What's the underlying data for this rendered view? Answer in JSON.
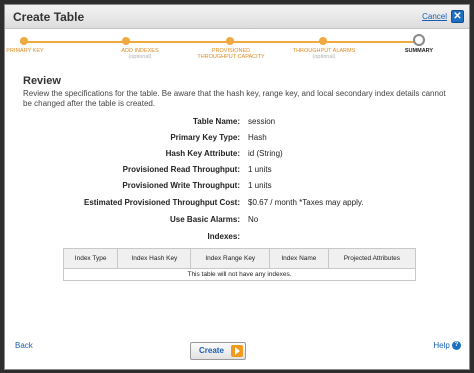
{
  "dialog": {
    "title": "Create Table",
    "cancel_label": "Cancel",
    "close_glyph": "✕"
  },
  "wizard": {
    "steps": [
      {
        "label": "PRIMARY KEY",
        "sub": ""
      },
      {
        "label": "ADD INDEXES",
        "sub": "(optional)"
      },
      {
        "label": "PROVISIONED THROUGHPUT CAPACITY",
        "sub": ""
      },
      {
        "label": "THROUGHPUT ALARMS",
        "sub": "(optional)"
      },
      {
        "label": "SUMMARY",
        "sub": ""
      }
    ],
    "current": "SUMMARY"
  },
  "review": {
    "heading": "Review",
    "intro": "Review the specifications for the table. Be aware that the hash key, range key, and local secondary index details cannot be changed after the table is created.",
    "fields": [
      {
        "label": "Table Name:",
        "value": "session"
      },
      {
        "label": "Primary Key Type:",
        "value": "Hash"
      },
      {
        "label": "Hash Key Attribute:",
        "value": "id (String)"
      },
      {
        "label": "Provisioned Read Throughput:",
        "value": "1 units"
      },
      {
        "label": "Provisioned Write Throughput:",
        "value": "1 units"
      },
      {
        "label": "Estimated Provisioned Throughput Cost:",
        "value": "$0.67 / month *Taxes may apply."
      },
      {
        "label": "Use Basic Alarms:",
        "value": "No"
      },
      {
        "label": "Indexes:",
        "value": ""
      }
    ]
  },
  "indexes_table": {
    "columns": [
      "Index Type",
      "Index Hash Key",
      "Index Range Key",
      "Index Name",
      "Projected Attributes"
    ],
    "empty_message": "This table will not have any indexes."
  },
  "footer": {
    "back_label": "Back",
    "create_label": "Create",
    "help_label": "Help",
    "help_glyph": "?"
  }
}
